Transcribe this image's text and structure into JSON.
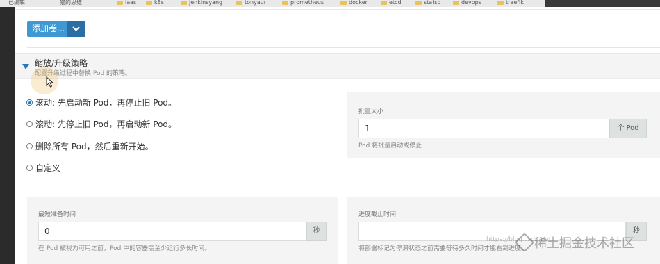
{
  "bookmarks": [
    "已编辑",
    "猫的思维",
    "iaas",
    "k8s",
    "jenkinsyang",
    "tonyaur",
    "prometheus",
    "docker",
    "etcd",
    "statsd",
    "devops",
    "traefik"
  ],
  "volume": {
    "add_label": "添加卷..."
  },
  "scaling": {
    "title": "缩放/升级策略",
    "description": "配置升级过程中替换 Pod 的策略。",
    "options": [
      {
        "label": "滚动: 先启动新 Pod，再停止旧 Pod。",
        "checked": true
      },
      {
        "label": "滚动: 先停止旧 Pod，再启动新 Pod。",
        "checked": false
      },
      {
        "label": "删除所有 Pod，然后重新开始。",
        "checked": false
      },
      {
        "label": "自定义",
        "checked": false
      }
    ],
    "batch_size": {
      "label": "批量大小",
      "value": "1",
      "unit": "个 Pod",
      "help": "Pod 将批量启动或停止"
    },
    "min_ready": {
      "label": "最短准备时间",
      "value": "0",
      "unit": "秒",
      "help": "在 Pod 被视为可用之前，Pod 中的容器需至少运行多长时间。"
    },
    "progress_deadline": {
      "label": "进度截止时间",
      "value": "",
      "unit": "秒",
      "help": "将部署标记为停滞状态之前需要等待多久时间才能看到进度。"
    }
  },
  "watermark": {
    "text": "稀土掘金技术社区",
    "url": "https://blog.csdn.net"
  },
  "colors": {
    "primary": "#3d98d3",
    "primary_dark": "#2b6ea3",
    "accent": "#2a76b8"
  }
}
